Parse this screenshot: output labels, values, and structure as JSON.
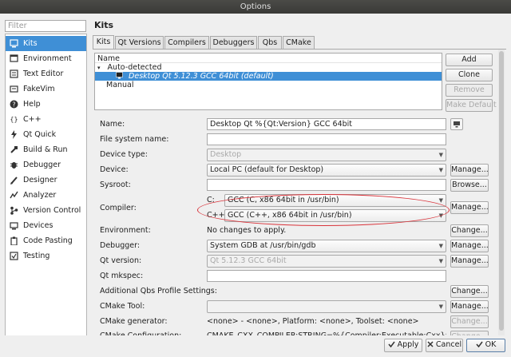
{
  "window": {
    "title": "Options"
  },
  "filter": {
    "placeholder": "Filter"
  },
  "sidebar": {
    "items": [
      {
        "label": "Kits",
        "icon": "kits-icon",
        "selected": true
      },
      {
        "label": "Environment",
        "icon": "environment-icon"
      },
      {
        "label": "Text Editor",
        "icon": "text-editor-icon"
      },
      {
        "label": "FakeVim",
        "icon": "fakevim-icon"
      },
      {
        "label": "Help",
        "icon": "help-icon"
      },
      {
        "label": "C++",
        "icon": "cpp-icon"
      },
      {
        "label": "Qt Quick",
        "icon": "qt-quick-icon"
      },
      {
        "label": "Build & Run",
        "icon": "build-run-icon"
      },
      {
        "label": "Debugger",
        "icon": "debugger-icon"
      },
      {
        "label": "Designer",
        "icon": "designer-icon"
      },
      {
        "label": "Analyzer",
        "icon": "analyzer-icon"
      },
      {
        "label": "Version Control",
        "icon": "version-control-icon"
      },
      {
        "label": "Devices",
        "icon": "devices-icon"
      },
      {
        "label": "Code Pasting",
        "icon": "code-pasting-icon"
      },
      {
        "label": "Testing",
        "icon": "testing-icon"
      }
    ]
  },
  "main": {
    "heading": "Kits",
    "tabs": [
      "Kits",
      "Qt Versions",
      "Compilers",
      "Debuggers",
      "Qbs",
      "CMake"
    ],
    "tree": {
      "header": "Name",
      "auto_detected": "Auto-detected",
      "selected_kit": "Desktop Qt 5.12.3 GCC 64bit (default)",
      "manual": "Manual"
    },
    "kit_buttons": {
      "add": "Add",
      "clone": "Clone",
      "remove": "Remove",
      "make_default": "Make Default"
    },
    "form": {
      "name_label": "Name:",
      "name_value": "Desktop Qt %{Qt:Version} GCC 64bit",
      "file_system_name_label": "File system name:",
      "device_type_label": "Device type:",
      "device_type_value": "Desktop",
      "device_label": "Device:",
      "device_value": "Local PC (default for Desktop)",
      "sysroot_label": "Sysroot:",
      "compiler_label": "Compiler:",
      "compiler_c_label": "C:",
      "compiler_c_value": "GCC (C, x86 64bit in /usr/bin)",
      "compiler_cpp_label": "C++:",
      "compiler_cpp_value": "GCC (C++, x86 64bit in /usr/bin)",
      "environment_label": "Environment:",
      "environment_value": "No changes to apply.",
      "debugger_label": "Debugger:",
      "debugger_value": "System GDB at /usr/bin/gdb",
      "qt_version_label": "Qt version:",
      "qt_version_value": "Qt 5.12.3 GCC 64bit",
      "qt_mkspec_label": "Qt mkspec:",
      "qbs_label": "Additional Qbs Profile Settings:",
      "cmake_tool_label": "CMake Tool:",
      "cmake_generator_label": "CMake generator:",
      "cmake_generator_value": "<none> - <none>, Platform: <none>, Toolset: <none>",
      "cmake_config_label": "CMake Configuration:",
      "cmake_config_value": "CMAKE_CXX_COMPILER:STRING=%{Compiler:Executable:Cxx}; CMAKE"
    },
    "buttons": {
      "manage": "Manage...",
      "browse": "Browse...",
      "change": "Change..."
    }
  },
  "footer": {
    "apply": "Apply",
    "cancel": "Cancel",
    "ok": "OK"
  },
  "colors": {
    "selection": "#3f8fd6",
    "annotation": "#d9333a"
  }
}
